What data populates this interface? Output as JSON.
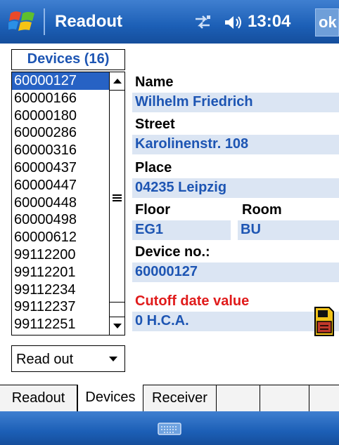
{
  "titlebar": {
    "app_title": "Readout",
    "time": "13:04",
    "ok_label": "ok"
  },
  "devices": {
    "header": "Devices (16)",
    "selected_index": 0,
    "items": [
      "60000127",
      "60000166",
      "60000180",
      "60000286",
      "60000316",
      "60000437",
      "60000447",
      "60000448",
      "60000498",
      "60000612",
      "99112200",
      "99112201",
      "99112234",
      "99112237",
      "99112251"
    ]
  },
  "mode_select": {
    "value": "Read out"
  },
  "details": {
    "name_label": "Name",
    "name_value": "Wilhelm Friedrich",
    "street_label": "Street",
    "street_value": "Karolinenstr. 108",
    "place_label": "Place",
    "place_value": "04235 Leipzig",
    "floor_label": "Floor",
    "floor_value": "EG1",
    "room_label": "Room",
    "room_value": "BU",
    "device_no_label": "Device no.:",
    "device_no_value": "60000127",
    "cutoff_label": "Cutoff date value",
    "cutoff_value": "0 H.C.A."
  },
  "tabs": [
    {
      "label": "Readout"
    },
    {
      "label": "Devices"
    },
    {
      "label": "Receiver"
    }
  ],
  "active_tab": "Devices",
  "colors": {
    "title_blue": "#1c5fb6",
    "accent_text": "#1d55b3",
    "field_bg": "#dbe5f3",
    "cutoff_red": "#e01b1b",
    "selection": "#2762c4"
  },
  "icons": {
    "start": "windows-flag-icon",
    "connectivity": "sync-arrows-icon",
    "volume": "speaker-icon",
    "save": "memory-card-icon",
    "keyboard": "keyboard-icon"
  }
}
